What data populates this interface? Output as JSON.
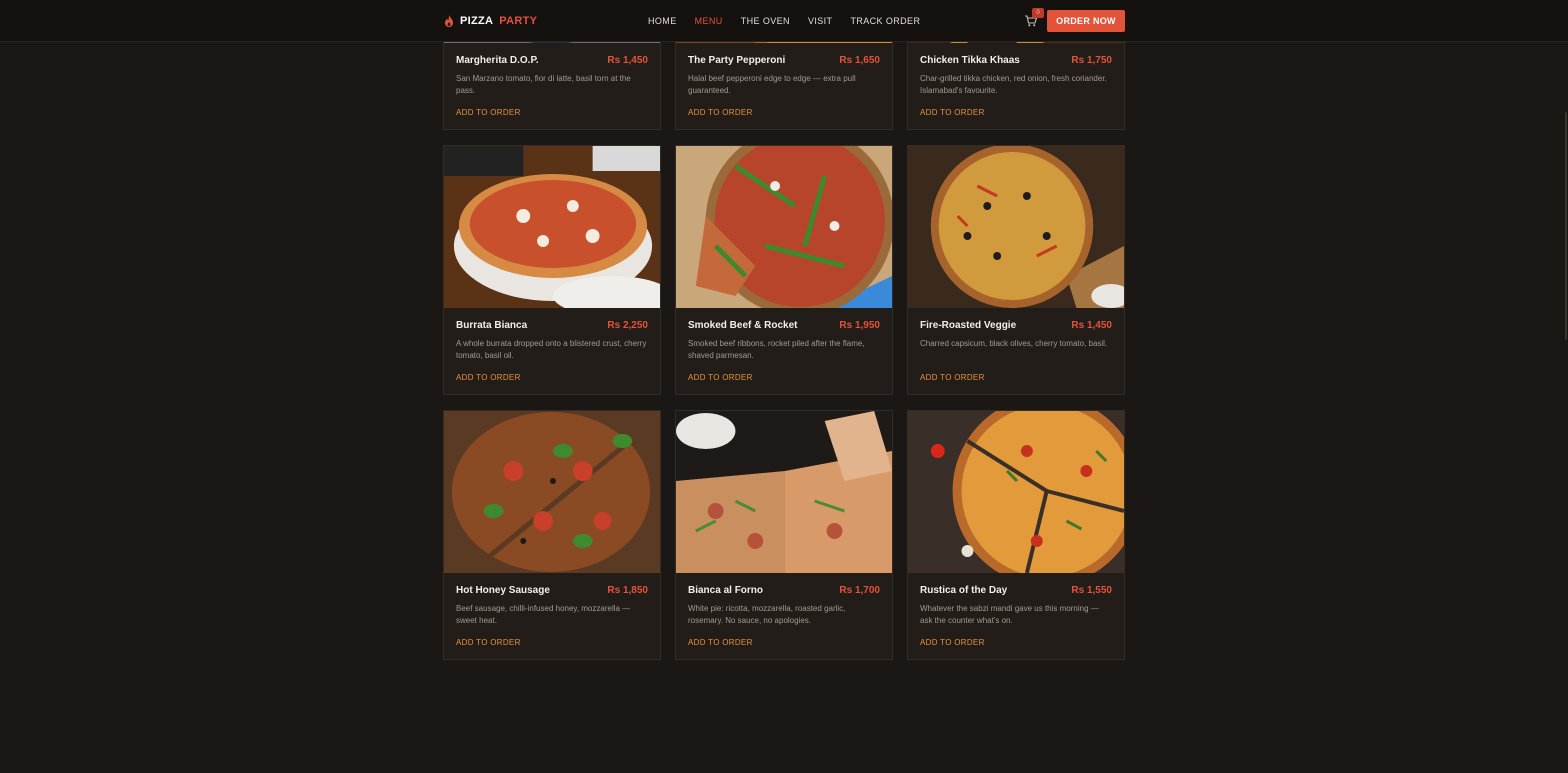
{
  "brand": {
    "name_a": "PIZZA",
    "name_b": "PARTY"
  },
  "nav": {
    "links": [
      "HOME",
      "MENU",
      "THE OVEN",
      "VISIT",
      "TRACK ORDER"
    ],
    "active": "MENU",
    "cart_count": "0",
    "order_button": "ORDER NOW"
  },
  "colors": {
    "accent": "#e3533a",
    "link": "#e8923a",
    "bg": "#1b1714",
    "card": "#221d19"
  },
  "menu": [
    {
      "name": "Margherita D.O.P.",
      "price": "Rs 1,450",
      "desc": "San Marzano tomato, fior di latte, basil torn at the pass.",
      "cta": "ADD TO ORDER"
    },
    {
      "name": "The Party Pepperoni",
      "price": "Rs 1,650",
      "desc": "Halal beef pepperoni edge to edge — extra pull guaranteed.",
      "cta": "ADD TO ORDER"
    },
    {
      "name": "Chicken Tikka Khaas",
      "price": "Rs 1,750",
      "desc": "Char-grilled tikka chicken, red onion, fresh coriander. Islamabad's favourite.",
      "cta": "ADD TO ORDER"
    },
    {
      "name": "Burrata Bianca",
      "price": "Rs 2,250",
      "desc": "A whole burrata dropped onto a blistered crust, cherry tomato, basil oil.",
      "cta": "ADD TO ORDER"
    },
    {
      "name": "Smoked Beef & Rocket",
      "price": "Rs 1,950",
      "desc": "Smoked beef ribbons, rocket piled after the flame, shaved parmesan.",
      "cta": "ADD TO ORDER"
    },
    {
      "name": "Fire-Roasted Veggie",
      "price": "Rs 1,450",
      "desc": "Charred capsicum, black olives, cherry tomato, basil.",
      "cta": "ADD TO ORDER"
    },
    {
      "name": "Hot Honey Sausage",
      "price": "Rs 1,850",
      "desc": "Beef sausage, chilli-infused honey, mozzarella — sweet heat.",
      "cta": "ADD TO ORDER"
    },
    {
      "name": "Bianca al Forno",
      "price": "Rs 1,700",
      "desc": "White pie: ricotta, mozzarella, roasted garlic, rosemary. No sauce, no apologies.",
      "cta": "ADD TO ORDER"
    },
    {
      "name": "Rustica of the Day",
      "price": "Rs 1,550",
      "desc": "Whatever the sabzi mandi gave us this morning — ask the counter what's on.",
      "cta": "ADD TO ORDER"
    }
  ]
}
